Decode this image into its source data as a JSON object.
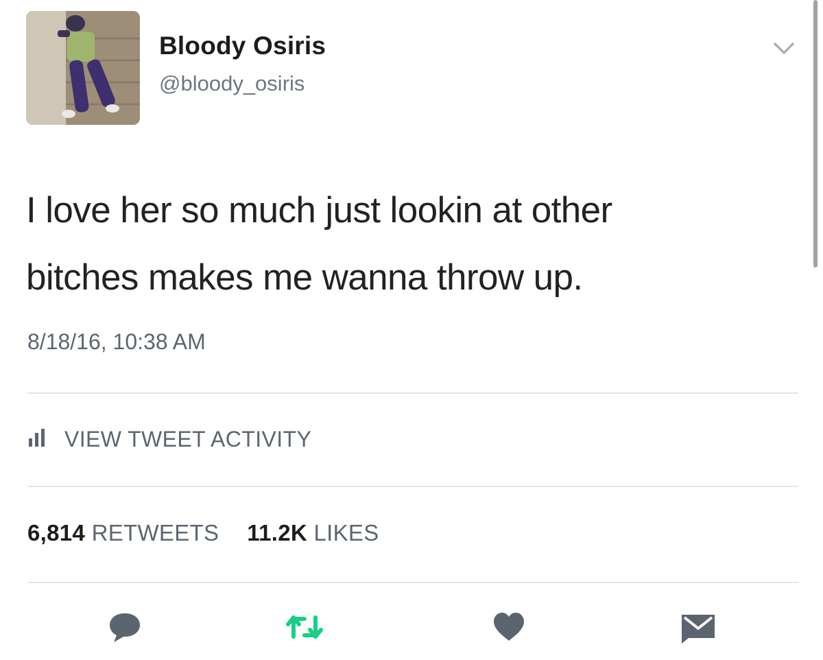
{
  "tweet": {
    "author": {
      "display_name": "Bloody Osiris",
      "handle": "@bloody_osiris"
    },
    "text_line1": "I love her so much just lookin at other",
    "text_line2": "bitches makes me wanna throw up.",
    "timestamp": "8/18/16, 10:38 AM",
    "activity_label": "VIEW TWEET ACTIVITY",
    "stats": {
      "retweets_count": "6,814",
      "retweets_label": "RETWEETS",
      "likes_count": "11.2K",
      "likes_label": "LIKES"
    }
  },
  "icons": {
    "menu": "chevron-down-icon",
    "activity": "bar-chart-icon",
    "reply": "reply-bubble-icon",
    "retweet": "retweet-icon",
    "like": "heart-icon",
    "message": "envelope-icon"
  },
  "colors": {
    "text_primary": "#1c1c1c",
    "text_secondary": "#5b6570",
    "icon_gray": "#5b6570",
    "retweet_green": "#19cf86",
    "divider": "#e1e5e9"
  }
}
